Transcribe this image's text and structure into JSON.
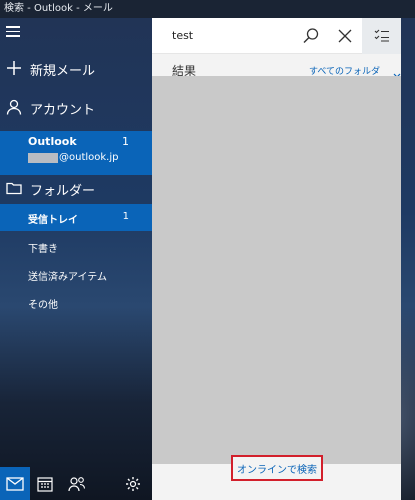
{
  "window": {
    "title": "検索 - Outlook - メール"
  },
  "nav": {
    "menu_icon": "hamburger-icon",
    "new_mail": "新規メール",
    "accounts": "アカウント",
    "account": {
      "name": "Outlook",
      "count": "1",
      "email_suffix": "@outlook.jp"
    },
    "folders": "フォルダー",
    "folder_items": [
      {
        "label": "受信トレイ",
        "count": "1"
      },
      {
        "label": "下書き"
      },
      {
        "label": "送信済みアイテム"
      },
      {
        "label": "その他"
      }
    ]
  },
  "bottom_bar": {
    "icons": [
      "mail-icon",
      "calendar-icon",
      "people-icon",
      "settings-icon"
    ]
  },
  "search": {
    "query": "test",
    "results_label": "結果",
    "folder_filter": "すべてのフォルダー",
    "online_search": "オンラインで検索"
  },
  "colors": {
    "accent": "#0a64b8",
    "highlight_border": "#d21f2b"
  }
}
